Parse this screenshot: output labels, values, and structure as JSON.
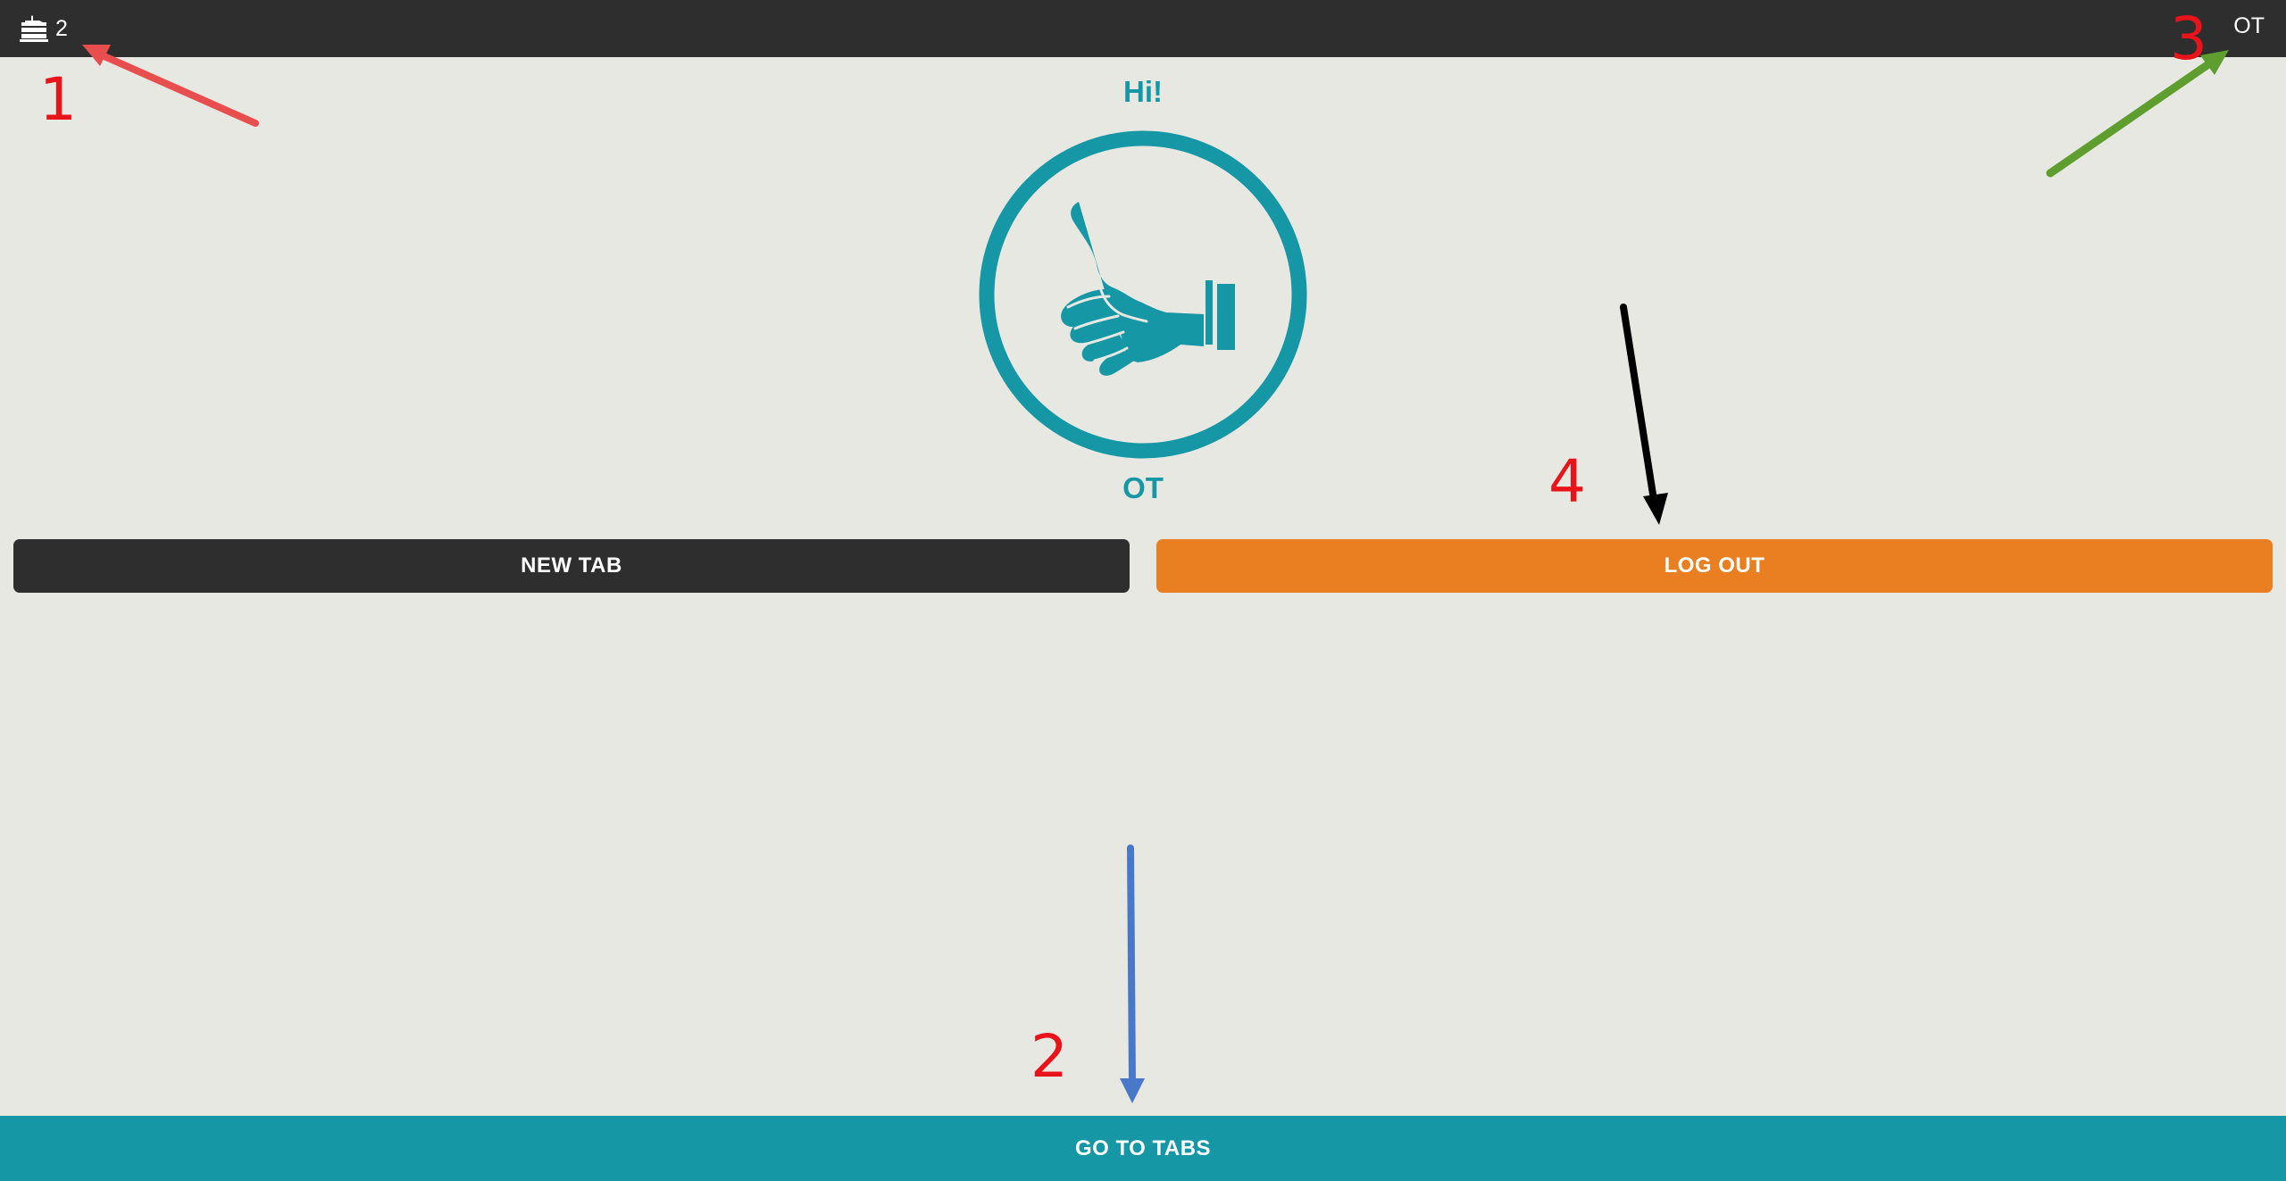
{
  "topbar": {
    "tabs_icon": "cake-stack-icon",
    "tabs_count": "2",
    "user_initials": "OT"
  },
  "main": {
    "greeting": "Hi!",
    "avatar_icon": "thumbs-up-icon",
    "user_initials": "OT"
  },
  "actions": {
    "new_tab_label": "NEW TAB",
    "logout_label": "LOG OUT"
  },
  "footer": {
    "go_to_tabs_label": "GO TO TABS"
  },
  "annotations": [
    {
      "label": "1",
      "color": "#e84e4e"
    },
    {
      "label": "2",
      "color": "#4a78c9"
    },
    {
      "label": "3",
      "color": "#5e9e2e"
    },
    {
      "label": "4",
      "color": "#000000"
    }
  ],
  "colors": {
    "accent": "#1597a5",
    "dark": "#2e2e2e",
    "logout": "#ea7f22",
    "background": "#e8e8e3",
    "annotation_number": "#e8141a"
  }
}
